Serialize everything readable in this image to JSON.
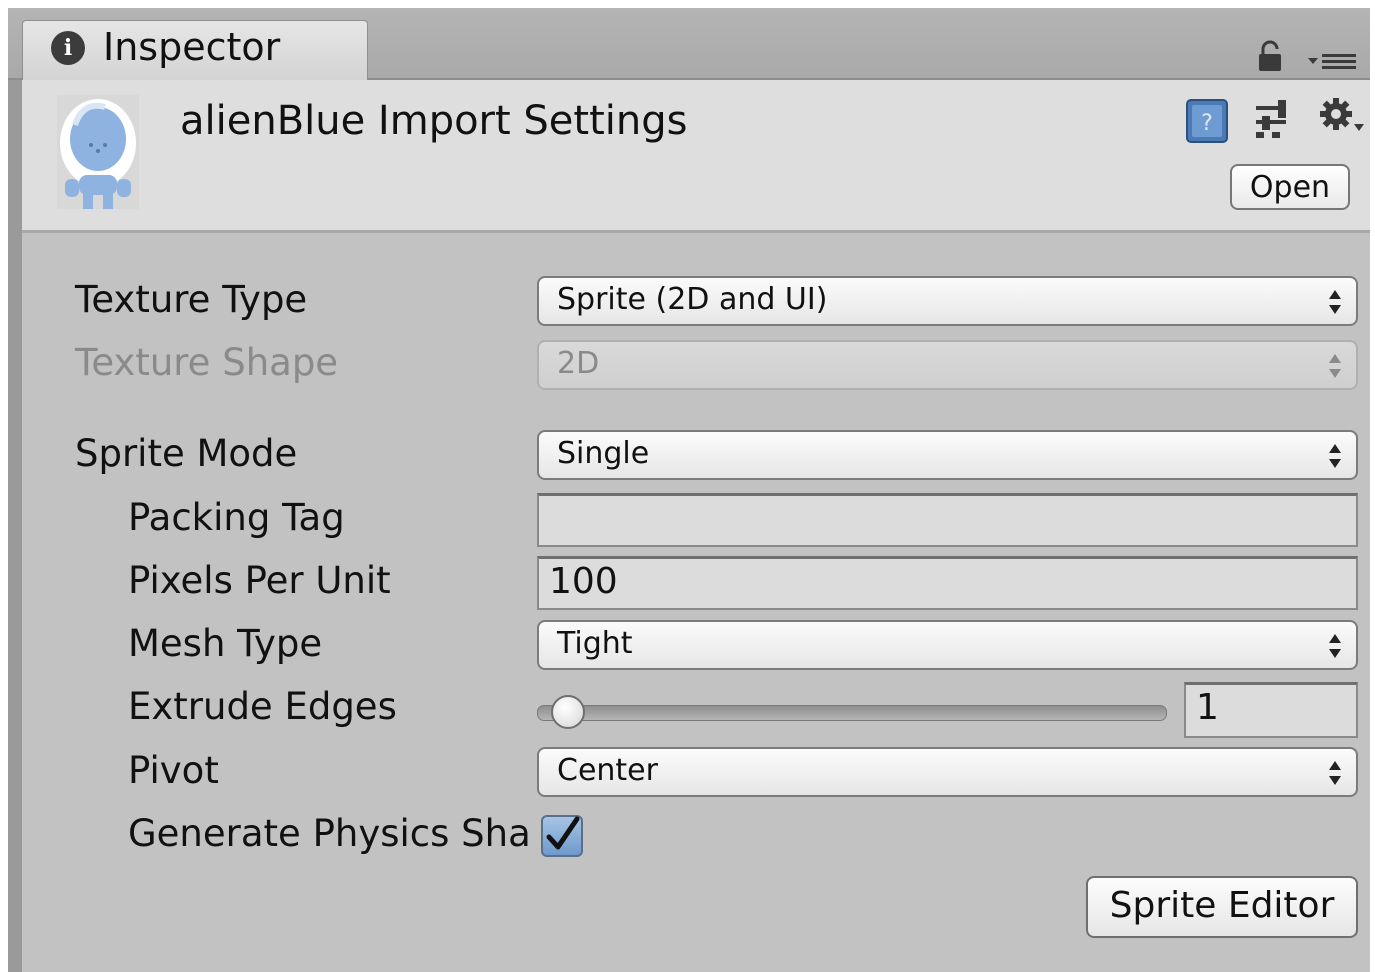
{
  "tab": {
    "label": "Inspector",
    "icon": "info-icon"
  },
  "header": {
    "title": "alienBlue Import Settings",
    "open_label": "Open",
    "icons": [
      "help-icon",
      "preset-icon",
      "gear-icon"
    ]
  },
  "settings": {
    "texture_type": {
      "label": "Texture Type",
      "value": "Sprite (2D and UI)"
    },
    "texture_shape": {
      "label": "Texture Shape",
      "value": "2D",
      "disabled": true
    },
    "sprite_mode": {
      "label": "Sprite Mode",
      "value": "Single"
    },
    "packing_tag": {
      "label": "Packing Tag",
      "value": ""
    },
    "pixels_per_unit": {
      "label": "Pixels Per Unit",
      "value": "100"
    },
    "mesh_type": {
      "label": "Mesh Type",
      "value": "Tight"
    },
    "extrude_edges": {
      "label": "Extrude Edges",
      "value": "1",
      "slider_min": 0,
      "slider_max": 32
    },
    "pivot": {
      "label": "Pivot",
      "value": "Center"
    },
    "generate_physics_shape": {
      "label": "Generate Physics Shape",
      "checked": true
    }
  },
  "sprite_editor_label": "Sprite Editor",
  "colors": {
    "panel_bg": "#c2c2c2",
    "header_bg": "#dedede",
    "checkbox_blue": "#6e9acc"
  }
}
